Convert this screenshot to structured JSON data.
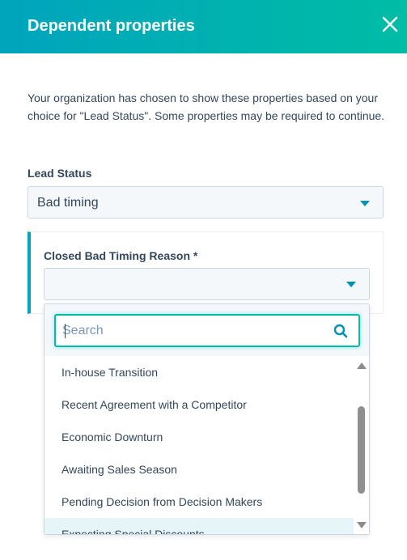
{
  "header": {
    "title": "Dependent properties",
    "close_icon": "close-icon",
    "background_from": "#00a4bd",
    "background_to": "#00bda5"
  },
  "intro": {
    "text": "Your organization has chosen to show these properties based on your choice for \"Lead Status\". Some properties may be required to continue."
  },
  "lead_status": {
    "label": "Lead Status",
    "value": "Bad timing",
    "caret_icon": "caret-down-icon"
  },
  "dependent": {
    "label": "Closed Bad Timing Reason *",
    "value": "",
    "caret_icon": "caret-down-icon",
    "accent_color": "#00a4bd"
  },
  "dropdown": {
    "search": {
      "placeholder": "Search",
      "value": "",
      "icon": "search-icon",
      "focus_color": "#00bda5"
    },
    "options": [
      "In-house Transition",
      "Recent Agreement with a Competitor",
      "Economic Downturn",
      "Awaiting Sales Season",
      "Pending Decision from Decision Makers",
      "Expecting Special Discounts"
    ],
    "hovered_option": "Expecting Special Discounts",
    "scroll_up_icon": "scroll-up-arrow-icon",
    "scroll_down_icon": "scroll-down-arrow-icon"
  }
}
